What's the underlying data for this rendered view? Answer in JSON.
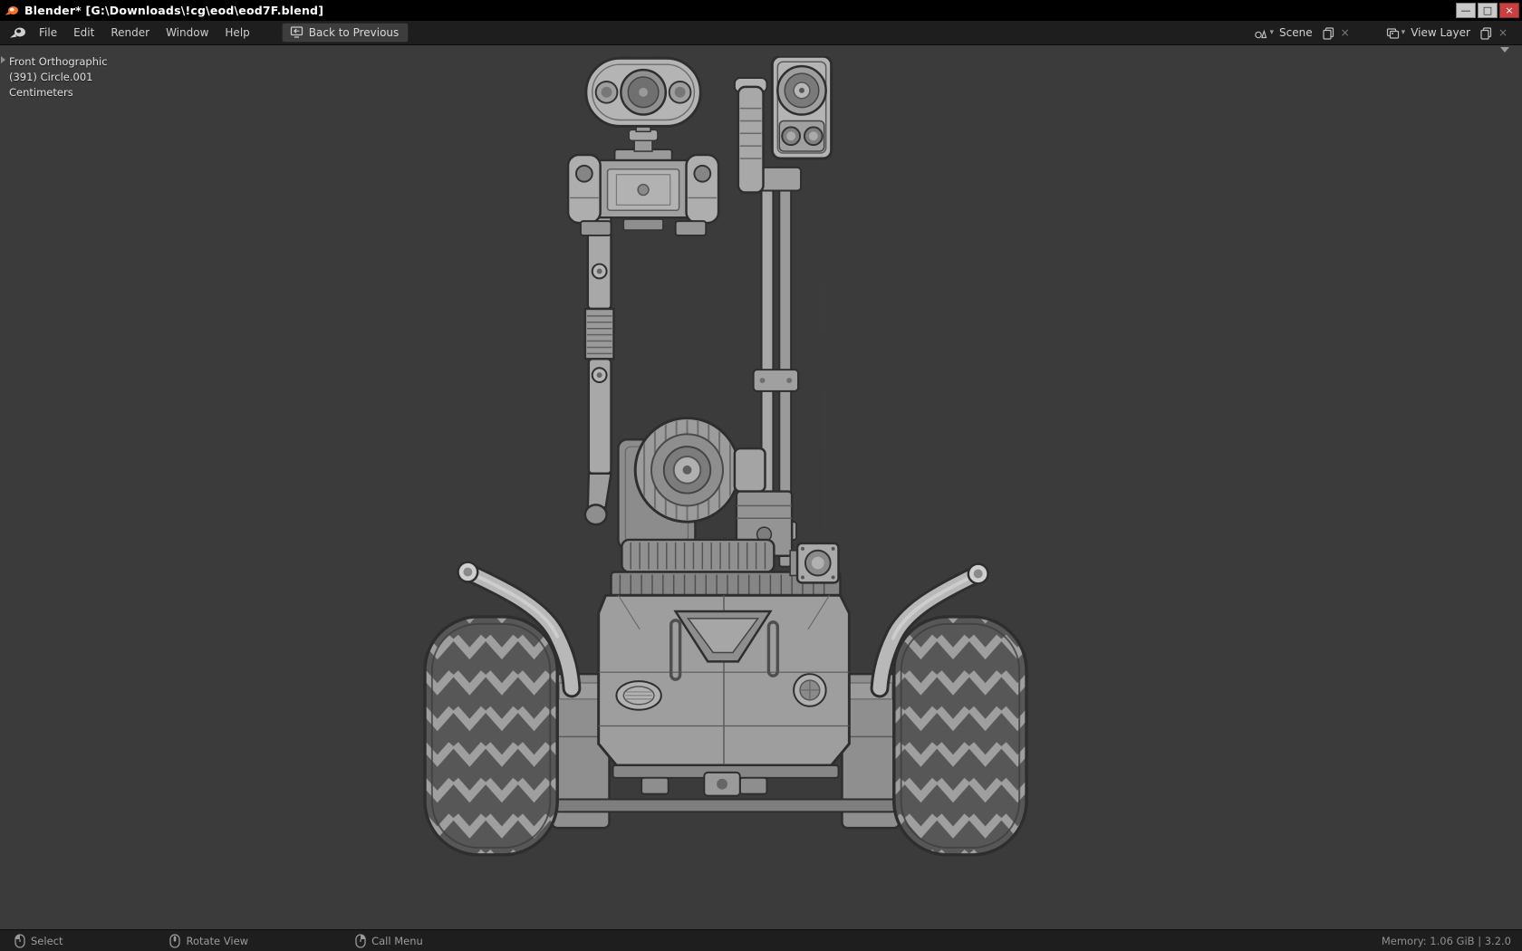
{
  "window": {
    "title": "Blender* [G:\\Downloads\\!cg\\eod\\eod7F.blend]",
    "minimize_glyph": "—",
    "maximize_glyph": "□",
    "close_glyph": "×"
  },
  "menubar": {
    "menus": [
      {
        "label": "File"
      },
      {
        "label": "Edit"
      },
      {
        "label": "Render"
      },
      {
        "label": "Window"
      },
      {
        "label": "Help"
      }
    ],
    "back_button": "Back to Previous",
    "scene": {
      "label": "Scene"
    },
    "view_layer": {
      "label": "View Layer"
    }
  },
  "viewport": {
    "overlay_lines": [
      "Front Orthographic",
      "(391) Circle.001",
      "Centimeters"
    ],
    "model_name": "EOD robot wireframe model, front orthographic view"
  },
  "statusbar": {
    "hints": [
      {
        "label": "Select"
      },
      {
        "label": "Rotate View"
      },
      {
        "label": "Call Menu"
      }
    ],
    "memory": "Memory: 1.06 GiB | 3.2.0"
  },
  "colors": {
    "titlebar_bg": "#000000",
    "header_bg": "#1e1e1e",
    "viewport_bg": "#3b3b3b",
    "close_button": "#c94040",
    "text": "#cecece",
    "blender_orange": "#ff7021"
  }
}
